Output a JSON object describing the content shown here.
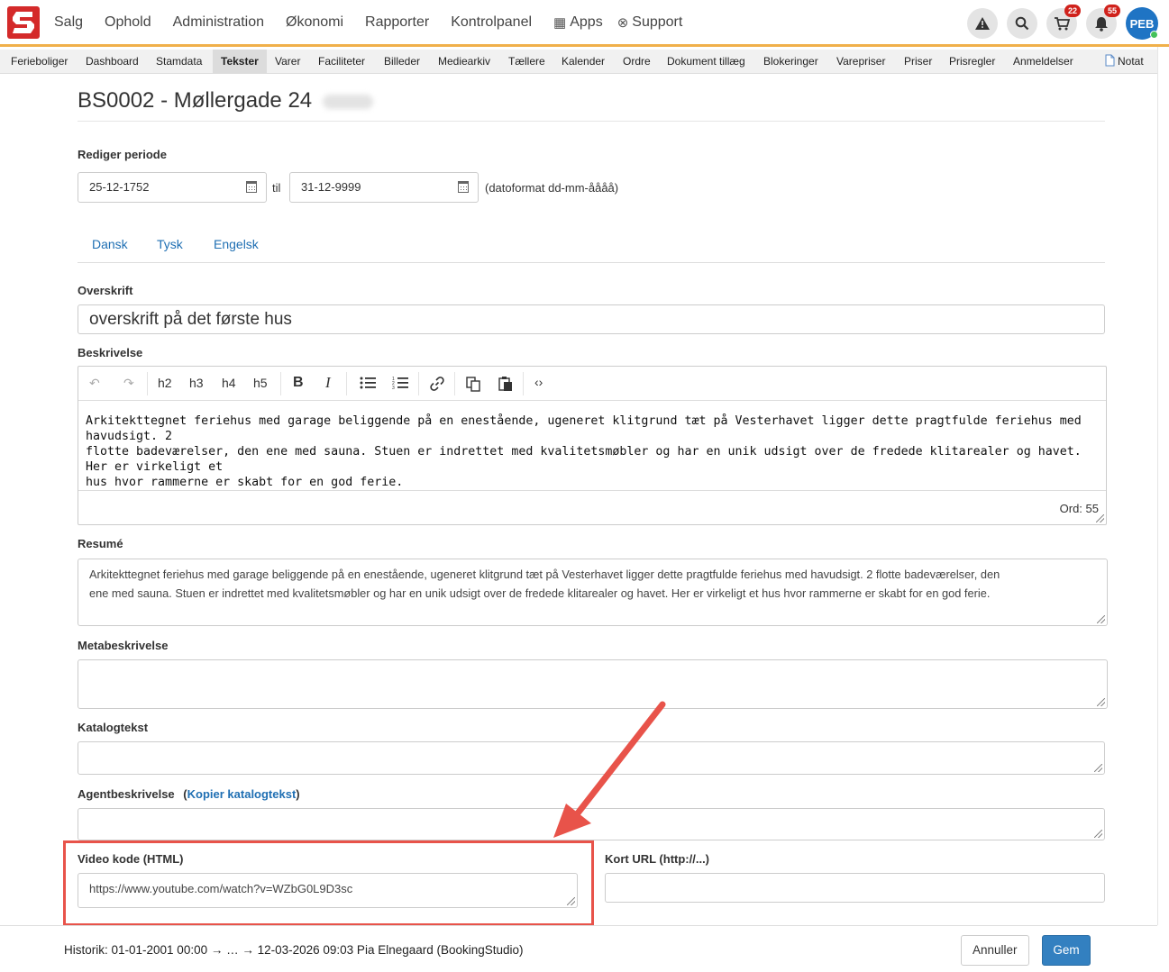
{
  "colors": {
    "accent": "#f0b04a",
    "brand": "#d42a2a",
    "link": "#1f6fb3",
    "primary_button": "#3380c0",
    "highlight": "#e8534a"
  },
  "nav": {
    "items": [
      {
        "label": "Salg"
      },
      {
        "label": "Ophold"
      },
      {
        "label": "Administration"
      },
      {
        "label": "Økonomi"
      },
      {
        "label": "Rapporter"
      },
      {
        "label": "Kontrolpanel"
      },
      {
        "label": "Apps",
        "icon": "grid-icon"
      },
      {
        "label": "Support",
        "icon": "lifebuoy-icon"
      }
    ],
    "cart_badge": "22",
    "notification_badge": "55",
    "avatar_initials": "PEB"
  },
  "subnav": {
    "items": [
      {
        "label": "Ferieboliger"
      },
      {
        "label": "Dashboard"
      },
      {
        "label": "Stamdata"
      },
      {
        "label": "Tekster",
        "active": true
      },
      {
        "label": "Varer"
      },
      {
        "label": "Faciliteter"
      },
      {
        "label": "Billeder"
      },
      {
        "label": "Mediearkiv"
      },
      {
        "label": "Tællere"
      },
      {
        "label": "Kalender"
      },
      {
        "label": "Ordre"
      },
      {
        "label": "Dokument tillæg"
      },
      {
        "label": "Blokeringer"
      },
      {
        "label": "Varepriser"
      },
      {
        "label": "Priser"
      },
      {
        "label": "Prisregler"
      },
      {
        "label": "Anmeldelser"
      }
    ],
    "note_label": "Notat"
  },
  "page": {
    "title": "BS0002 - Møllergade 24"
  },
  "period": {
    "label": "Rediger periode",
    "from": "25-12-1752",
    "til_label": "til",
    "to": "31-12-9999",
    "format_hint": "(datoformat dd-mm-åååå)"
  },
  "tabs": [
    {
      "label": "Dansk"
    },
    {
      "label": "Tysk"
    },
    {
      "label": "Engelsk"
    }
  ],
  "form": {
    "heading_label": "Overskrift",
    "heading_value": "overskrift på det første hus",
    "description_label": "Beskrivelse",
    "toolbar": [
      "h2",
      "h3",
      "h4",
      "h5"
    ],
    "description_lines": [
      "Arkitekttegnet feriehus med garage beliggende på en enestående, ugeneret klitgrund tæt på Vesterhavet ligger dette pragtfulde feriehus med havudsigt. 2",
      "flotte badeværelser, den ene med sauna. Stuen er indrettet med kvalitetsmøbler og har en unik udsigt over de fredede klitarealer og havet. Her er virkeligt et",
      "hus hvor rammerne er skabt for en god ferie."
    ],
    "word_count": "Ord: 55",
    "summary_label": "Resumé",
    "summary_lines": [
      "Arkitekttegnet feriehus med garage beliggende på en enestående, ugeneret klitgrund tæt på Vesterhavet ligger dette pragtfulde feriehus med havudsigt. 2 flotte badeværelser, den",
      "ene med  sauna. Stuen er indrettet med kvalitetsmøbler og har en unik udsigt over de fredede klitarealer og havet. Her er virkeligt et hus hvor rammerne er skabt for en god ferie."
    ],
    "meta_label": "Metabeskrivelse",
    "meta_value": "",
    "catalog_label": "Katalogtekst",
    "catalog_value": "",
    "agent_label": "Agentbeskrivelse",
    "agent_copy_prefix": "(",
    "agent_copy_link": "Kopier katalogtekst",
    "agent_copy_suffix": ")",
    "agent_value": "",
    "video_label": "Video kode (HTML)",
    "video_value": "https://www.youtube.com/watch?v=WZbG0L9D3sc",
    "short_url_label": "Kort URL (http://...)",
    "short_url_value": ""
  },
  "footer": {
    "history": "Historik: 01-01-2001 00:00 → … → 12-03-2026 09:03 Pia Elnegaard (BookingStudio)",
    "cancel_label": "Annuller",
    "save_label": "Gem"
  }
}
